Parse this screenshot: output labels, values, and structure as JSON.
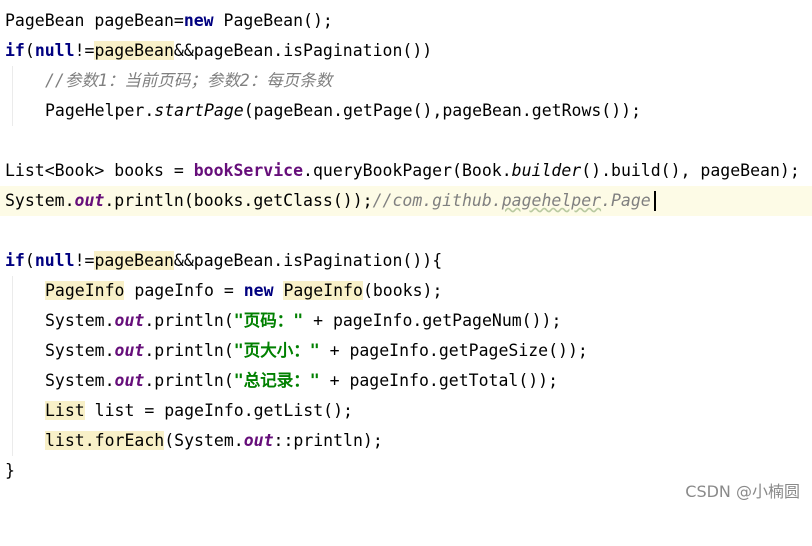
{
  "editor": {
    "top_partial": "  //  ...  ",
    "lines": {
      "l1": {
        "a": "PageBean pageBean=",
        "kw": "new",
        "b": " PageBean();"
      },
      "l2": {
        "kw": "if",
        "p1": "(",
        "kw2": "null",
        "p2": "!=",
        "hl": "pageBean",
        "rest": "&&pageBean.isPagination())"
      },
      "l3": {
        "comment": "//参数1：当前页码；参数2：每页条数"
      },
      "l4": {
        "a": "PageHelper.",
        "method": "startPage",
        "b": "(pageBean.getPage(),pageBean.getRows());"
      },
      "l5": {
        "a": "List<Book> books = ",
        "bold": "bookService",
        "b": ".queryBookPager(Book.",
        "method": "builder",
        "c": "().build(), pageBean);"
      },
      "l6": {
        "a": "System.",
        "field": "out",
        "b": ".println(books.getClass());",
        "comment": "//com.github.",
        "typo": "pagehelper",
        "comment2": ".Page"
      },
      "l7": {
        "kw": "if",
        "p1": "(",
        "kw2": "null",
        "p2": "!=",
        "hl": "pageBean",
        "rest": "&&pageBean.isPagination()){"
      },
      "l8": {
        "hl1": "PageInfo",
        "a": " pageInfo = ",
        "kw": "new",
        "sp": " ",
        "hl2": "PageInfo",
        "b": "(books);"
      },
      "l9": {
        "a": "System.",
        "field": "out",
        "b": ".println(",
        "str": "\"页码：\"",
        "c": " + pageInfo.getPageNum());"
      },
      "l10": {
        "a": "System.",
        "field": "out",
        "b": ".println(",
        "str": "\"页大小：\"",
        "c": " + pageInfo.getPageSize());"
      },
      "l11": {
        "a": "System.",
        "field": "out",
        "b": ".println(",
        "str": "\"总记录：\"",
        "c": " + pageInfo.getTotal());"
      },
      "l12": {
        "hl": "List",
        "a": " list = pageInfo.getList();"
      },
      "l13": {
        "hl": "list.forEach",
        "a": "(System.",
        "field": "out",
        "b": "::println);"
      },
      "l14": {
        "a": "}"
      }
    }
  },
  "watermark": "CSDN @小楠圆"
}
